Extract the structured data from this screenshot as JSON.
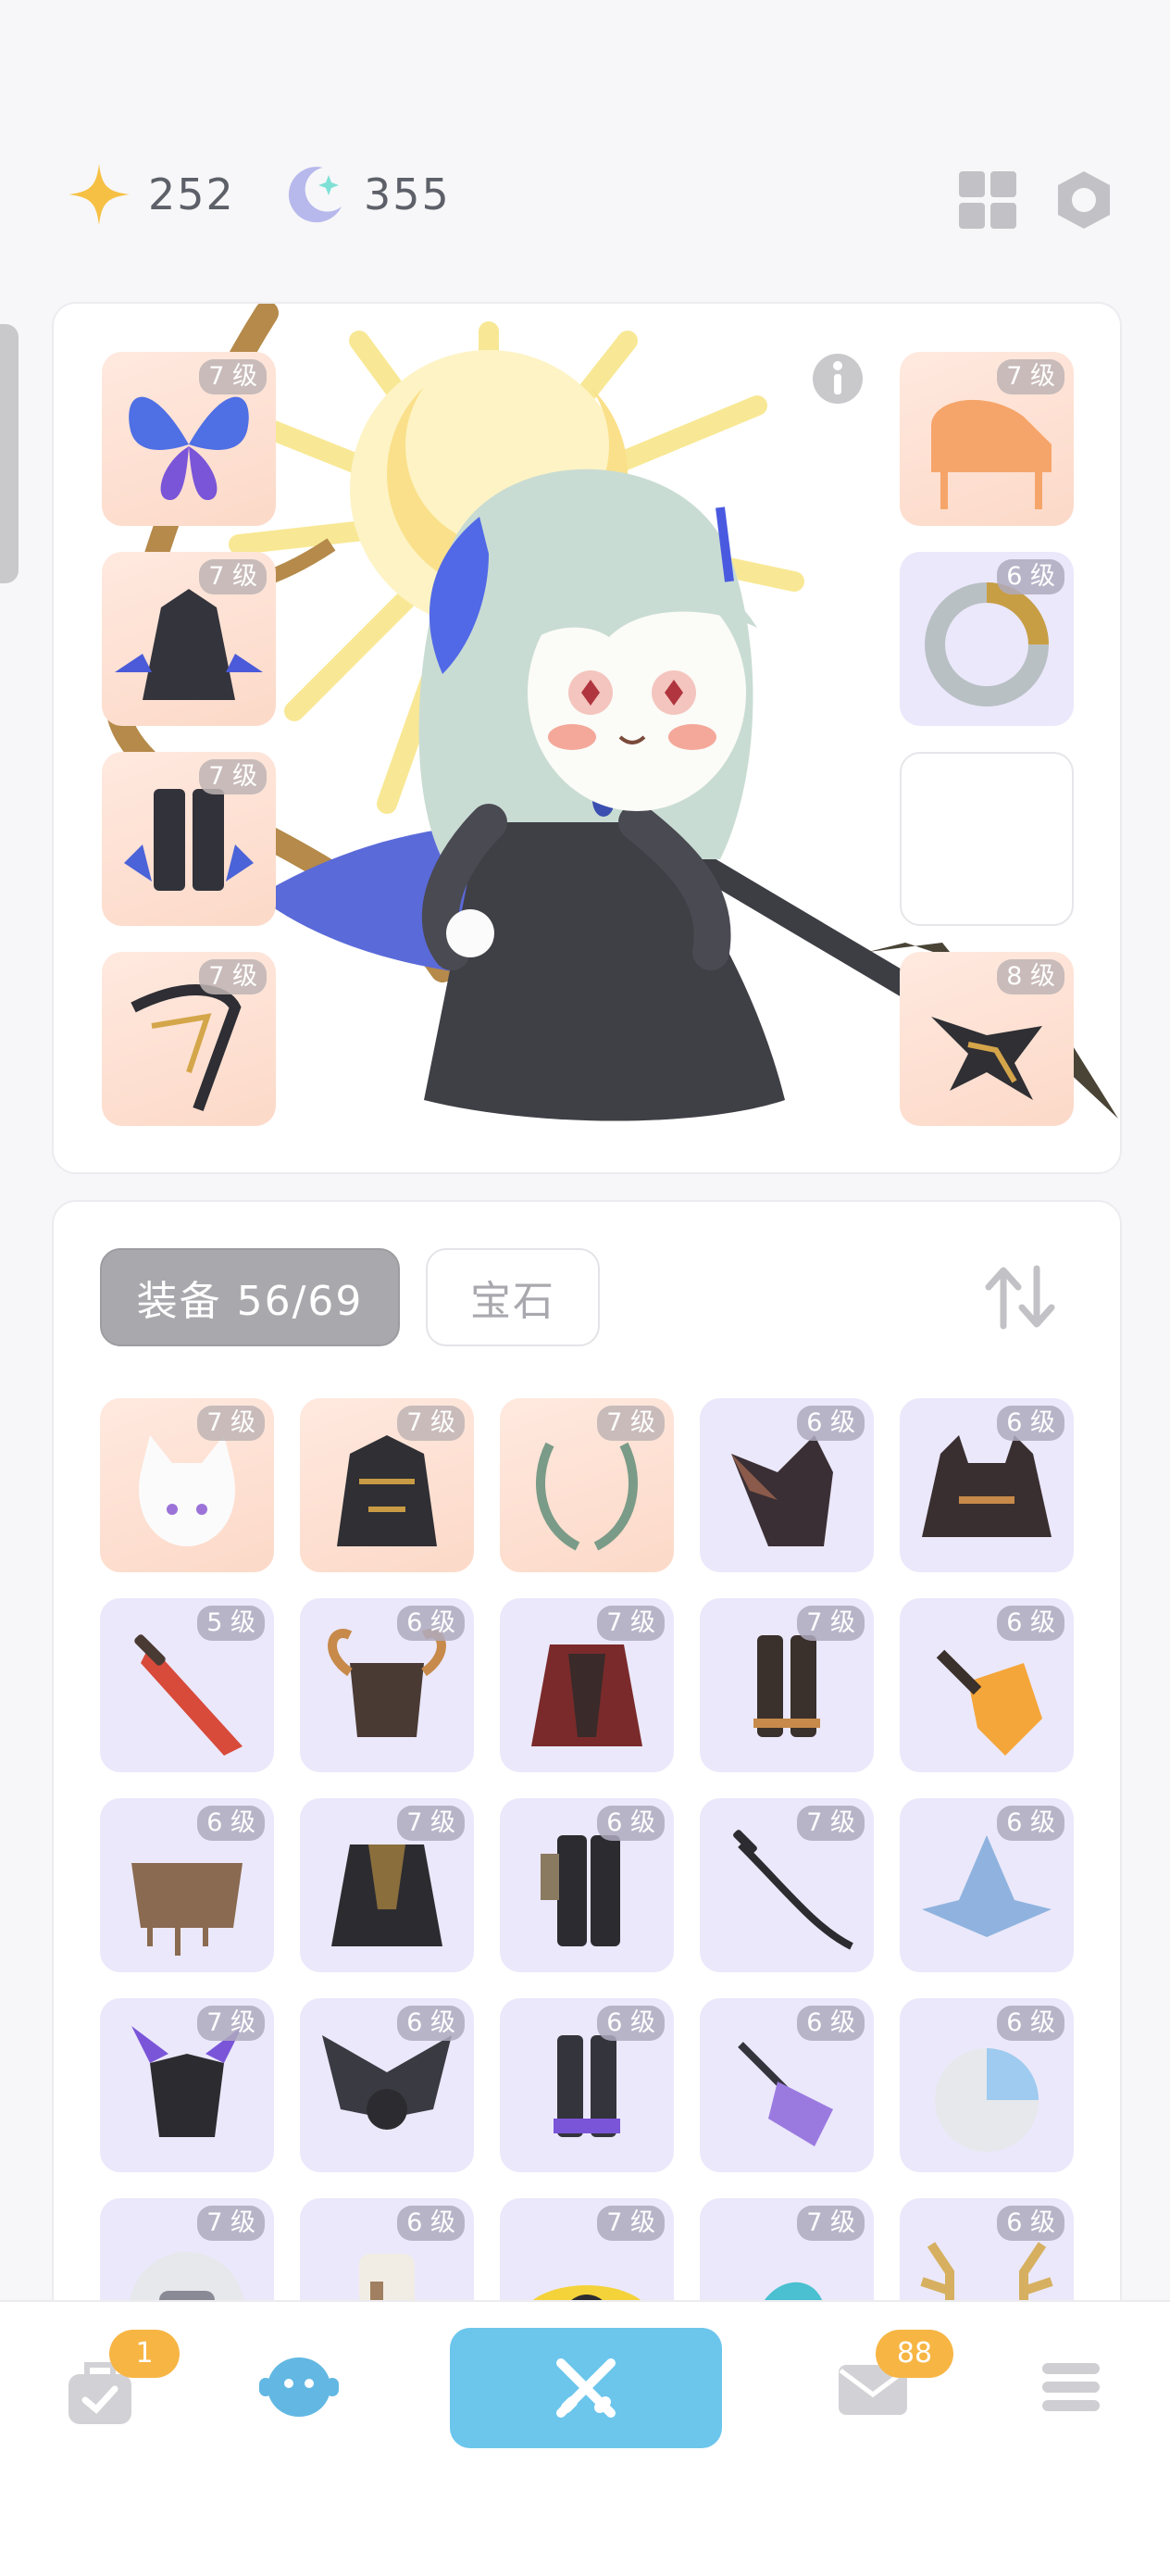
{
  "currency": {
    "stars": "252",
    "moons": "355"
  },
  "equipped": {
    "left": [
      {
        "level": "7 级",
        "icon": "butterfly-wings-icon",
        "tone": "warm"
      },
      {
        "level": "7 级",
        "icon": "dark-cloak-icon",
        "tone": "warm"
      },
      {
        "level": "7 级",
        "icon": "dark-boots-icon",
        "tone": "warm"
      },
      {
        "level": "7 级",
        "icon": "golden-branch-icon",
        "tone": "warm"
      }
    ],
    "right": [
      {
        "level": "7 级",
        "icon": "piano-icon",
        "tone": "warm"
      },
      {
        "level": "6 级",
        "icon": "serpent-ring-icon",
        "tone": "cool"
      },
      {
        "level": "",
        "icon": "empty-slot",
        "tone": "empty"
      },
      {
        "level": "8 级",
        "icon": "dragon-icon",
        "tone": "warm"
      }
    ]
  },
  "inventory": {
    "tab_equipment": "装备 56/69",
    "tab_gems": "宝石",
    "items": [
      {
        "level": "7 级",
        "icon": "cat-mask-icon",
        "tone": "warm"
      },
      {
        "level": "7 级",
        "icon": "gold-armor-icon",
        "tone": "warm"
      },
      {
        "level": "7 级",
        "icon": "laurel-icon",
        "tone": "warm"
      },
      {
        "level": "6 级",
        "icon": "bat-hood-icon",
        "tone": "cool"
      },
      {
        "level": "6 级",
        "icon": "horned-cape-icon",
        "tone": "cool"
      },
      {
        "level": "5 级",
        "icon": "red-sword-icon",
        "tone": "cool"
      },
      {
        "level": "6 级",
        "icon": "horned-helm-icon",
        "tone": "cool"
      },
      {
        "level": "7 级",
        "icon": "red-robe-icon",
        "tone": "cool"
      },
      {
        "level": "7 级",
        "icon": "brown-boots-icon",
        "tone": "cool"
      },
      {
        "level": "6 级",
        "icon": "fire-sword-icon",
        "tone": "cool"
      },
      {
        "level": "6 级",
        "icon": "brown-cape-icon",
        "tone": "cool"
      },
      {
        "level": "7 级",
        "icon": "black-coat-icon",
        "tone": "cool"
      },
      {
        "level": "6 级",
        "icon": "black-pants-icon",
        "tone": "cool"
      },
      {
        "level": "7 级",
        "icon": "katana-icon",
        "tone": "cool"
      },
      {
        "level": "6 级",
        "icon": "blue-hat-icon",
        "tone": "cool"
      },
      {
        "level": "7 级",
        "icon": "demon-mask-icon",
        "tone": "cool"
      },
      {
        "level": "6 级",
        "icon": "bat-wings-icon",
        "tone": "cool"
      },
      {
        "level": "6 级",
        "icon": "purple-boots-icon",
        "tone": "cool"
      },
      {
        "level": "6 级",
        "icon": "crystal-wand-icon",
        "tone": "cool"
      },
      {
        "level": "6 级",
        "icon": "robot-helmet-icon",
        "tone": "cool"
      },
      {
        "level": "7 级",
        "icon": "astronaut-icon",
        "tone": "cool"
      },
      {
        "level": "6 级",
        "icon": "skull-icon",
        "tone": "cool"
      },
      {
        "level": "7 级",
        "icon": "sun-eye-icon",
        "tone": "cool"
      },
      {
        "level": "7 级",
        "icon": "blue-ribbon-icon",
        "tone": "cool"
      },
      {
        "level": "6 级",
        "icon": "antlers-icon",
        "tone": "cool"
      }
    ]
  },
  "bottom_nav": {
    "bag_badge": "1",
    "mail_badge": "88"
  },
  "colors": {
    "accent_blue": "#6cc6ec",
    "badge_orange": "#f7b544",
    "warm_slot": "#fcd9c8",
    "cool_slot": "#ebe8fb"
  }
}
